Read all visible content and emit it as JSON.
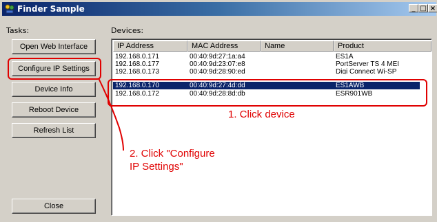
{
  "window": {
    "title": "Finder Sample",
    "controls": {
      "minimize": "_",
      "maximize": "□",
      "close": "×"
    }
  },
  "tasks": {
    "label": "Tasks:",
    "buttons": [
      {
        "label": "Open Web Interface"
      },
      {
        "label": "Configure IP Settings"
      },
      {
        "label": "Device Info"
      },
      {
        "label": "Reboot Device"
      },
      {
        "label": "Refresh List"
      }
    ],
    "close_label": "Close"
  },
  "devices": {
    "label": "Devices:",
    "columns": [
      "IP Address",
      "MAC Address",
      "Name",
      "Product"
    ],
    "rows": [
      {
        "ip": "192.168.0.171",
        "mac": "00:40:9d:27:1a:a4",
        "name": "",
        "product": "ES1A",
        "selected": false
      },
      {
        "ip": "192.168.0.177",
        "mac": "00:40:9d:23:07:e8",
        "name": "",
        "product": "PortServer TS 4 MEI",
        "selected": false
      },
      {
        "ip": "192.168.0.173",
        "mac": "00:40:9d:28:90:ed",
        "name": "",
        "product": "Digi Connect Wi-SP",
        "selected": false
      },
      {
        "ip": "192.168.0.170",
        "mac": "00:40:9d:27:4d:dd",
        "name": "",
        "product": "ES1AWB",
        "selected": true
      },
      {
        "ip": "192.168.0.172",
        "mac": "00:40:9d:28:8d:db",
        "name": "",
        "product": "ESR901WB",
        "selected": false
      }
    ]
  },
  "annotations": {
    "step1": "1. Click device",
    "step2_line1": "2. Click \"Configure",
    "step2_line2": "IP Settings\"",
    "color": "#e00000"
  }
}
